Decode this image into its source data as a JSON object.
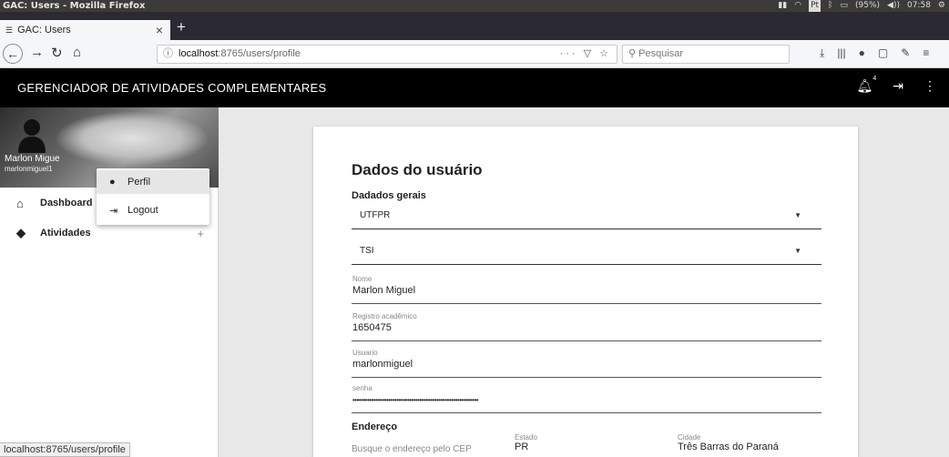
{
  "os": {
    "window_title": "GAC: Users - Mozilla Firefox",
    "battery": "(95%)",
    "clock": "07:58",
    "lang": "Pt"
  },
  "browser": {
    "tab_title": "GAC: Users",
    "url_host": "localhost",
    "url_path": ":8765/users/profile",
    "search_placeholder": "Pesquisar",
    "status_url": "localhost:8765/users/profile"
  },
  "app": {
    "title": "GERENCIADOR DE ATIVIDADES COMPLEMENTARES",
    "notif_badge": "4"
  },
  "sidebar": {
    "user_name": "Marlon Migue",
    "user_email": "marlonmiguel1",
    "items": [
      {
        "label": "Dashboard",
        "icon": "home-icon"
      },
      {
        "label": "Atividades",
        "icon": "tag-icon",
        "expander": "+"
      }
    ]
  },
  "user_menu": {
    "items": [
      {
        "label": "Perfil",
        "icon": "person-icon"
      },
      {
        "label": "Logout",
        "icon": "logout-icon"
      }
    ]
  },
  "form": {
    "title": "Dados do usuário",
    "section_general": "Dadados gerais",
    "institution": "UTFPR",
    "course": "TSI",
    "fields": [
      {
        "label": "Nome",
        "value": "Marlon Miguel"
      },
      {
        "label": "Registro acadêmico",
        "value": "1650475"
      },
      {
        "label": "Usuario",
        "value": "marlonmiguel"
      },
      {
        "label": "senha",
        "value": "••••••••••••••••••••••••••••••••••••••••••••••••••••••••••••"
      }
    ],
    "section_address": "Endereço",
    "cep_label": "Busque o endereço pelo CEP",
    "estado_label": "Estado",
    "estado_value": "PR",
    "cidade_label": "Cidade",
    "cidade_value": "Três Barras do Paraná"
  }
}
